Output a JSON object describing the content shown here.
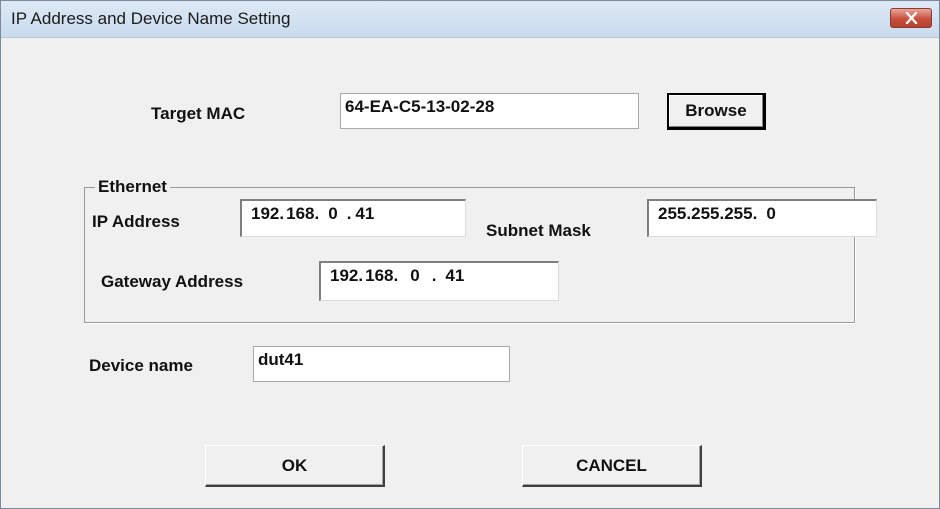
{
  "window": {
    "title": "IP Address and Device Name Setting"
  },
  "target_mac": {
    "label": "Target MAC",
    "value": "64-EA-C5-13-02-28",
    "browse_label": "Browse"
  },
  "ethernet": {
    "legend": "Ethernet",
    "ip_address": {
      "label": "IP Address",
      "octets": [
        "192",
        "168",
        "0",
        "41"
      ]
    },
    "subnet_mask": {
      "label": "Subnet Mask",
      "octets": [
        "255",
        "255",
        "255",
        "0"
      ]
    },
    "gateway_address": {
      "label": "Gateway Address",
      "octets": [
        "192",
        "168",
        "0",
        "41"
      ]
    }
  },
  "device_name": {
    "label": "Device name",
    "value": "dut41"
  },
  "buttons": {
    "ok_label": "OK",
    "cancel_label": "CANCEL"
  },
  "icons": {
    "close": "close-icon"
  },
  "colors": {
    "close_button": "#c7503c",
    "dialog_background": "#f0f0f0"
  }
}
